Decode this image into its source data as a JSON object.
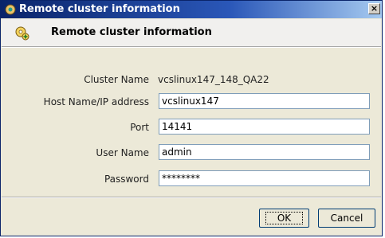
{
  "window": {
    "title": "Remote cluster information",
    "close_glyph": "×"
  },
  "banner": {
    "title": "Remote cluster information",
    "icon": "gear-add-icon"
  },
  "form": {
    "cluster_name": {
      "label": "Cluster Name",
      "value": "vcslinux147_148_QA22"
    },
    "host": {
      "label": "Host Name/IP address",
      "value": "vcslinux147"
    },
    "port": {
      "label": "Port",
      "value": "14141"
    },
    "user": {
      "label": "User Name",
      "value": "admin"
    },
    "password": {
      "label": "Password",
      "value": "********"
    }
  },
  "buttons": {
    "ok": "OK",
    "cancel": "Cancel"
  }
}
